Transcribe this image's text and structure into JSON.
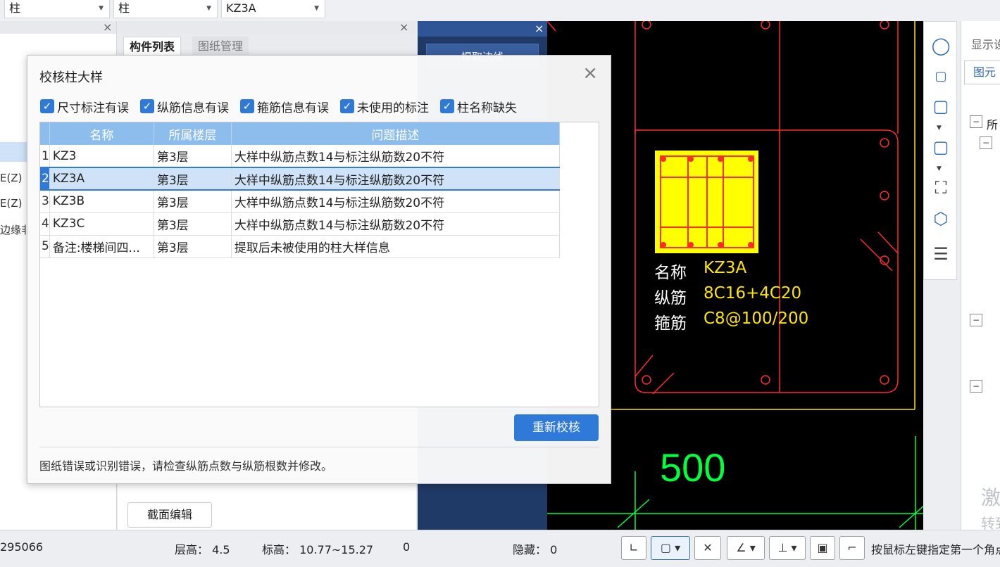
{
  "toolbar": {
    "dropdown1": "柱",
    "dropdown2": "柱",
    "dropdown3": "KZ3A"
  },
  "left_panel": {
    "items": [
      "E(Z)",
      "E(Z)",
      "边缘非"
    ]
  },
  "component_panel": {
    "tabs": [
      "构件列表",
      "图纸管理"
    ],
    "section_edit_label": "截面编辑"
  },
  "extract_panel": {
    "button_label": "提取边线"
  },
  "cad": {
    "name_label": "名称",
    "name_value": "KZ3A",
    "long_rebar_label": "纵筋",
    "long_rebar_value": "8C16+4C20",
    "stirrup_label": "箍筋",
    "stirrup_value": "C8@100/200",
    "dimension": "500",
    "colors": {
      "background": "#000000",
      "outline": "#ff2a2a",
      "section_fill": "#ffff00",
      "label_text": "#ffffff",
      "value_text": "#ffe600",
      "dimension": "#00ff3c"
    }
  },
  "right_panel": {
    "title": "显示设",
    "tab": "图元",
    "tree_nodes": [
      "所",
      "",
      "",
      "",
      ""
    ],
    "watermark": [
      "激",
      "转到"
    ]
  },
  "dialog": {
    "title": "校核柱大样",
    "filters": [
      {
        "label": "尺寸标注有误",
        "checked": true
      },
      {
        "label": "纵筋信息有误",
        "checked": true
      },
      {
        "label": "箍筋信息有误",
        "checked": true
      },
      {
        "label": "未使用的标注",
        "checked": true
      },
      {
        "label": "柱名称缺失",
        "checked": true
      }
    ],
    "columns": [
      "名称",
      "所属楼层",
      "问题描述"
    ],
    "rows": [
      {
        "no": "1",
        "name": "KZ3",
        "floor": "第3层",
        "desc": "大样中纵筋点数14与标注纵筋数20不符"
      },
      {
        "no": "2",
        "name": "KZ3A",
        "floor": "第3层",
        "desc": "大样中纵筋点数14与标注纵筋数20不符"
      },
      {
        "no": "3",
        "name": "KZ3B",
        "floor": "第3层",
        "desc": "大样中纵筋点数14与标注纵筋数20不符"
      },
      {
        "no": "4",
        "name": "KZ3C",
        "floor": "第3层",
        "desc": "大样中纵筋点数14与标注纵筋数20不符"
      },
      {
        "no": "5",
        "name": "备注:楼梯间四...",
        "floor": "第3层",
        "desc": "提取后未被使用的柱大样信息"
      }
    ],
    "selected_row": 2,
    "recheck_label": "重新校核",
    "hint": "图纸错误或识别错误，请检查纵筋点数与纵筋根数并修改。"
  },
  "statusbar": {
    "coords": "295066",
    "floor_height": "层高：  4.5",
    "elevation": "标高：  10.77~15.27",
    "zero": "0",
    "hidden": "隐藏：  0",
    "prompt": "按鼠标左键指定第一个角点"
  }
}
